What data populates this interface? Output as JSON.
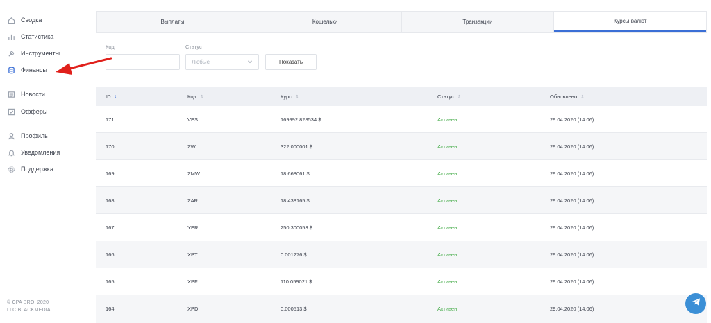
{
  "sidebar": {
    "items": [
      {
        "label": "Сводка",
        "icon": "home-icon"
      },
      {
        "label": "Статистика",
        "icon": "bar-chart-icon"
      },
      {
        "label": "Инструменты",
        "icon": "wrench-icon"
      },
      {
        "label": "Финансы",
        "icon": "database-icon",
        "active": true
      },
      {
        "label": "Новости",
        "icon": "newspaper-icon"
      },
      {
        "label": "Офферы",
        "icon": "checklist-icon"
      },
      {
        "label": "Профиль",
        "icon": "user-icon"
      },
      {
        "label": "Уведомления",
        "icon": "bell-icon"
      },
      {
        "label": "Поддержка",
        "icon": "gear-icon"
      }
    ],
    "footer_line1": "© CPA BRO, 2020",
    "footer_line2": "LLC BLACKMEDIA"
  },
  "tabs": [
    {
      "label": "Выплаты"
    },
    {
      "label": "Кошельки"
    },
    {
      "label": "Транзакции"
    },
    {
      "label": "Курсы валют",
      "active": true
    }
  ],
  "filters": {
    "code_label": "Код",
    "code_value": "",
    "status_label": "Статус",
    "status_selected": "Любые",
    "show_button": "Показать"
  },
  "table": {
    "columns": [
      "ID",
      "Код",
      "Курс",
      "Статус",
      "Обновлено"
    ],
    "rows": [
      {
        "id": "171",
        "code": "VES",
        "rate": "169992.828534 $",
        "status": "Активен",
        "updated": "29.04.2020 (14:06)"
      },
      {
        "id": "170",
        "code": "ZWL",
        "rate": "322.000001 $",
        "status": "Активен",
        "updated": "29.04.2020 (14:06)"
      },
      {
        "id": "169",
        "code": "ZMW",
        "rate": "18.668061 $",
        "status": "Активен",
        "updated": "29.04.2020 (14:06)"
      },
      {
        "id": "168",
        "code": "ZAR",
        "rate": "18.438165 $",
        "status": "Активен",
        "updated": "29.04.2020 (14:06)"
      },
      {
        "id": "167",
        "code": "YER",
        "rate": "250.300053 $",
        "status": "Активен",
        "updated": "29.04.2020 (14:06)"
      },
      {
        "id": "166",
        "code": "XPT",
        "rate": "0.001276 $",
        "status": "Активен",
        "updated": "29.04.2020 (14:06)"
      },
      {
        "id": "165",
        "code": "XPF",
        "rate": "110.059021 $",
        "status": "Активен",
        "updated": "29.04.2020 (14:06)"
      },
      {
        "id": "164",
        "code": "XPD",
        "rate": "0.000513 $",
        "status": "Активен",
        "updated": "29.04.2020 (14:06)"
      }
    ]
  },
  "colors": {
    "accent": "#3b6fd6",
    "status_active": "#4caf50",
    "annotation_arrow": "#e0201b",
    "telegram": "#3b8fd6"
  },
  "telegram_icon": "telegram-icon"
}
